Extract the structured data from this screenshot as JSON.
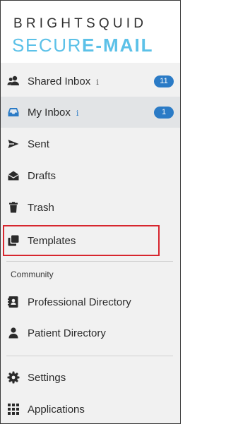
{
  "logo": {
    "line1": "BRIGHTSQUID",
    "line2_a": "SECUR",
    "line2_b": "E-MAIL"
  },
  "nav": {
    "shared_inbox": {
      "label": "Shared Inbox",
      "info": "i",
      "badge": "11"
    },
    "my_inbox": {
      "label": "My Inbox",
      "info": "i",
      "badge": "1"
    },
    "sent": {
      "label": "Sent"
    },
    "drafts": {
      "label": "Drafts"
    },
    "trash": {
      "label": "Trash"
    },
    "templates": {
      "label": "Templates"
    }
  },
  "community": {
    "heading": "Community",
    "professional_directory": "Professional Directory",
    "patient_directory": "Patient Directory"
  },
  "footer": {
    "settings": "Settings",
    "applications": "Applications"
  },
  "colors": {
    "accent": "#2b7bc6",
    "logo_blue": "#5cc1e8",
    "highlight": "#d7262e",
    "active_bg": "#e2e4e6"
  },
  "icons": [
    "users-icon",
    "inbox-icon",
    "paper-plane-icon",
    "envelope-open-icon",
    "trash-icon",
    "clone-icon",
    "address-card-icon",
    "user-icon",
    "gear-icon",
    "grid-icon"
  ]
}
